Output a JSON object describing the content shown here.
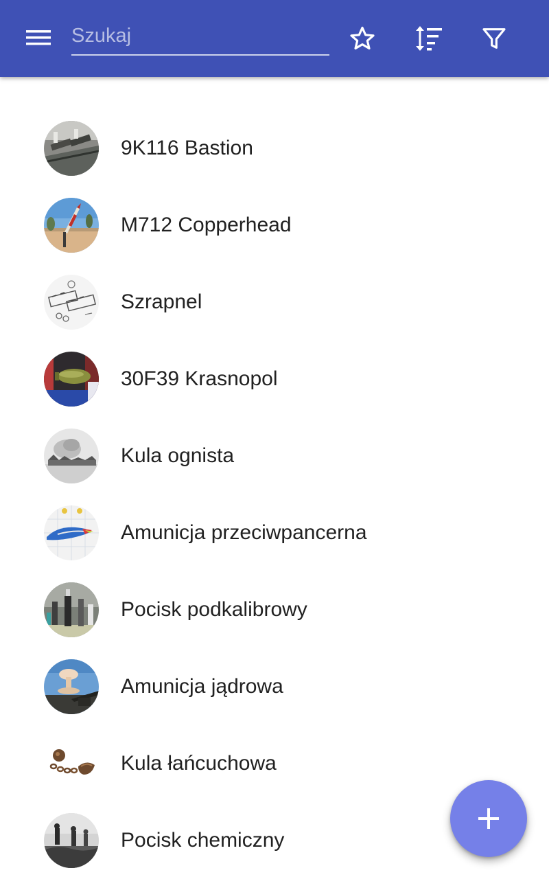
{
  "toolbar": {
    "menu_icon": "menu-icon",
    "search_placeholder": "Szukaj",
    "search_value": "",
    "favorites_icon": "star-outline-icon",
    "sort_icon": "sort-icon",
    "filter_icon": "filter-icon",
    "color": "#3f51b5"
  },
  "list": {
    "items": [
      {
        "label": "9K116 Bastion"
      },
      {
        "label": "M712 Copperhead"
      },
      {
        "label": "Szrapnel"
      },
      {
        "label": "30F39 Krasnopol"
      },
      {
        "label": "Kula ognista"
      },
      {
        "label": "Amunicja przeciwpancerna"
      },
      {
        "label": "Pocisk podkalibrowy"
      },
      {
        "label": "Amunicja jądrowa"
      },
      {
        "label": "Kula łańcuchowa"
      },
      {
        "label": "Pocisk chemiczny"
      }
    ]
  },
  "fab": {
    "icon": "plus-icon",
    "color": "#7580e8"
  }
}
